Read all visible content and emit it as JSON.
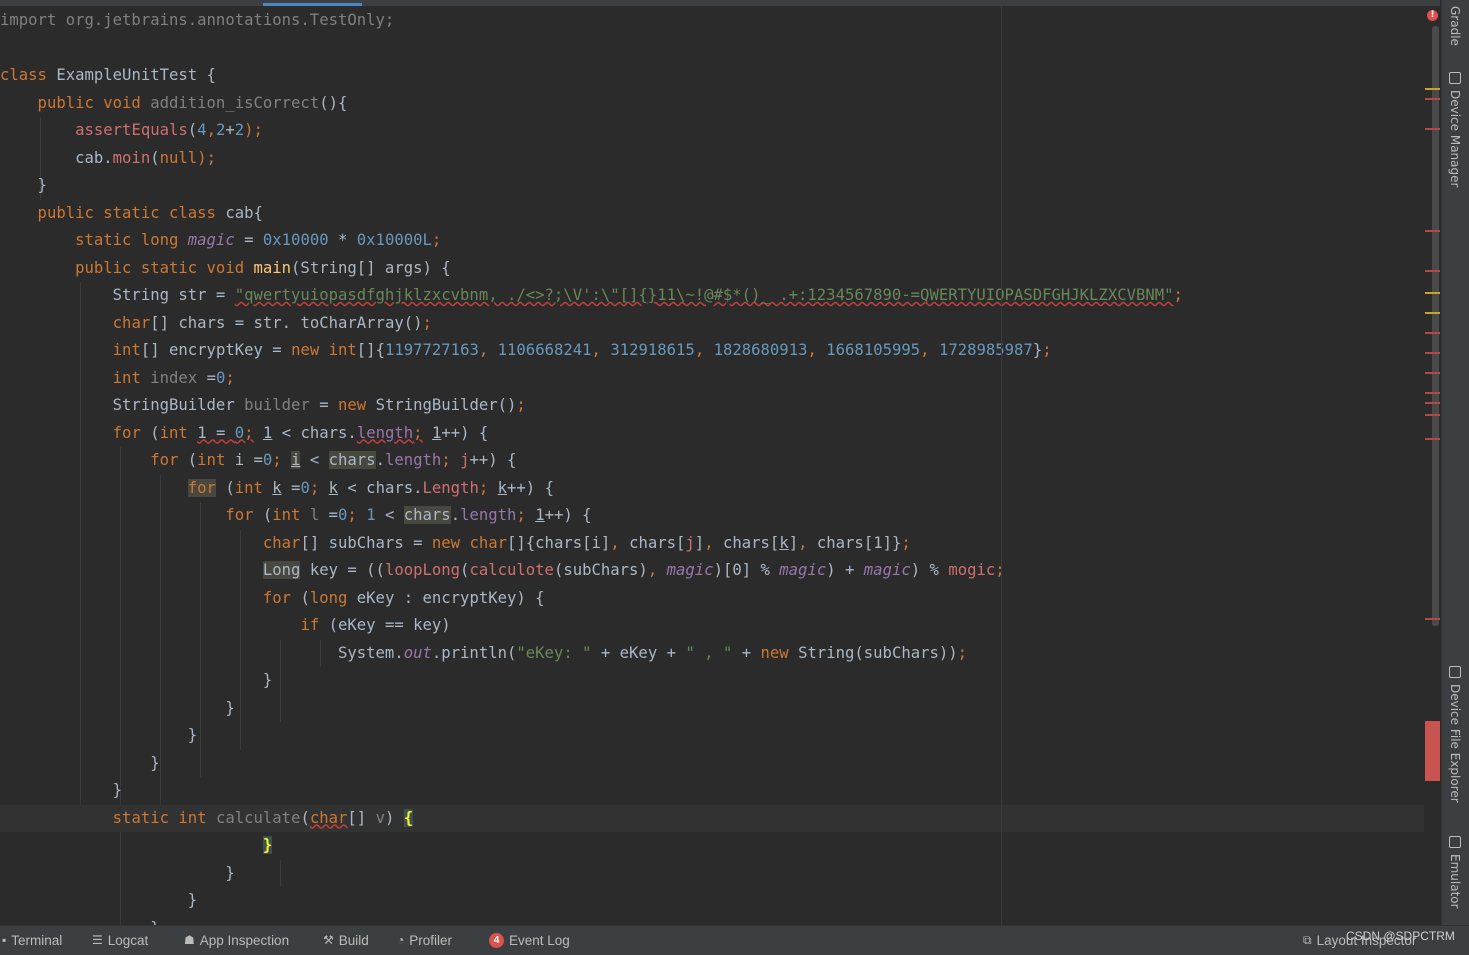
{
  "editor": {
    "lines": [
      {
        "segs": [
          {
            "t": "import org.jetbrains.annotations.TestOnly;",
            "c": "gry"
          }
        ]
      },
      {
        "segs": []
      },
      {
        "segs": [
          {
            "t": "class ",
            "c": "kw"
          },
          {
            "t": "ExampleUnitTest {",
            "c": ""
          }
        ]
      },
      {
        "segs": [
          {
            "t": "    public void ",
            "c": "kw"
          },
          {
            "t": "addition_isCorrect",
            "c": "gry"
          },
          {
            "t": "(){",
            "c": ""
          }
        ]
      },
      {
        "segs": [
          {
            "t": "        ",
            "c": ""
          },
          {
            "t": "assertEquals",
            "c": "mth"
          },
          {
            "t": "(",
            "c": ""
          },
          {
            "t": "4",
            "c": "num"
          },
          {
            "t": ",",
            "c": "kw"
          },
          {
            "t": "2",
            "c": "num"
          },
          {
            "t": "+",
            "c": ""
          },
          {
            "t": "2",
            "c": "num"
          },
          {
            "t": ");",
            "c": "kw"
          }
        ]
      },
      {
        "segs": [
          {
            "t": "        cab.",
            "c": ""
          },
          {
            "t": "moin",
            "c": "mth"
          },
          {
            "t": "(",
            "c": ""
          },
          {
            "t": "null",
            "c": "kw"
          },
          {
            "t": ");",
            "c": "kw"
          }
        ]
      },
      {
        "segs": [
          {
            "t": "    }",
            "c": ""
          }
        ]
      },
      {
        "segs": [
          {
            "t": "    public static class ",
            "c": "kw"
          },
          {
            "t": "cab{",
            "c": ""
          }
        ]
      },
      {
        "segs": [
          {
            "t": "        static long ",
            "c": "kw"
          },
          {
            "t": "magic",
            "c": "itl"
          },
          {
            "t": " = ",
            "c": ""
          },
          {
            "t": "0x10000",
            "c": "num"
          },
          {
            "t": " * ",
            "c": ""
          },
          {
            "t": "0x10000L",
            "c": "num"
          },
          {
            "t": ";",
            "c": "kw"
          }
        ]
      },
      {
        "segs": [
          {
            "t": "        public static void ",
            "c": "kw"
          },
          {
            "t": "main",
            "c": "fn"
          },
          {
            "t": "(String[] args) {",
            "c": ""
          }
        ]
      },
      {
        "segs": [
          {
            "t": "            String str = ",
            "c": ""
          },
          {
            "t": "\"qwertyuiopasdfghjklzxcvbnm, ./<>?;\\V':\\\"[]{}11\\~!@#$*()_ .+:1234567890-=QWERTYUIOPASDFGHJKLZXCVBNM\"",
            "c": "str err"
          },
          {
            "t": ";",
            "c": "kw"
          }
        ]
      },
      {
        "segs": [
          {
            "t": "            ",
            "c": ""
          },
          {
            "t": "char",
            "c": "kw"
          },
          {
            "t": "[] chars = str. toCharArray()",
            "c": ""
          },
          {
            "t": ";",
            "c": "kw"
          }
        ]
      },
      {
        "segs": [
          {
            "t": "            ",
            "c": ""
          },
          {
            "t": "int",
            "c": "kw"
          },
          {
            "t": "[] encryptKey = ",
            "c": ""
          },
          {
            "t": "new ",
            "c": "kw"
          },
          {
            "t": "int",
            "c": "kw"
          },
          {
            "t": "[]{",
            "c": ""
          },
          {
            "t": "1197727163",
            "c": "num"
          },
          {
            "t": ", ",
            "c": "kw"
          },
          {
            "t": "1106668241",
            "c": "num"
          },
          {
            "t": ", ",
            "c": "kw"
          },
          {
            "t": "312918615",
            "c": "num"
          },
          {
            "t": ", ",
            "c": "kw"
          },
          {
            "t": "1828680913",
            "c": "num"
          },
          {
            "t": ", ",
            "c": "kw"
          },
          {
            "t": "1668105995",
            "c": "num"
          },
          {
            "t": ", ",
            "c": "kw"
          },
          {
            "t": "1728985987",
            "c": "num"
          },
          {
            "t": "}",
            "c": ""
          },
          {
            "t": ";",
            "c": "kw"
          }
        ]
      },
      {
        "segs": [
          {
            "t": "            ",
            "c": ""
          },
          {
            "t": "int ",
            "c": "kw"
          },
          {
            "t": "index",
            "c": "gry"
          },
          {
            "t": " =",
            "c": ""
          },
          {
            "t": "0",
            "c": "num"
          },
          {
            "t": ";",
            "c": "kw"
          }
        ]
      },
      {
        "segs": [
          {
            "t": "            StringBuilder ",
            "c": ""
          },
          {
            "t": "builder",
            "c": "gry"
          },
          {
            "t": " = ",
            "c": ""
          },
          {
            "t": "new ",
            "c": "kw"
          },
          {
            "t": "StringBuilder()",
            "c": ""
          },
          {
            "t": ";",
            "c": "kw"
          }
        ]
      },
      {
        "segs": [
          {
            "t": "            ",
            "c": ""
          },
          {
            "t": "for ",
            "c": "kw"
          },
          {
            "t": "(",
            "c": ""
          },
          {
            "t": "int ",
            "c": "kw"
          },
          {
            "t": "1 = ",
            "c": "err"
          },
          {
            "t": "0",
            "c": "num err"
          },
          {
            "t": ";",
            "c": "kw err"
          },
          {
            "t": " ",
            "c": ""
          },
          {
            "t": "1",
            "c": "usc"
          },
          {
            "t": " < chars.",
            "c": ""
          },
          {
            "t": "length",
            "c": "purp err"
          },
          {
            "t": ";",
            "c": "kw err"
          },
          {
            "t": " ",
            "c": ""
          },
          {
            "t": "1",
            "c": "usc"
          },
          {
            "t": "++) {",
            "c": ""
          }
        ]
      },
      {
        "segs": [
          {
            "t": "                ",
            "c": ""
          },
          {
            "t": "for ",
            "c": "kw"
          },
          {
            "t": "(",
            "c": ""
          },
          {
            "t": "int ",
            "c": "kw"
          },
          {
            "t": "i =",
            "c": ""
          },
          {
            "t": "0",
            "c": "num"
          },
          {
            "t": "; ",
            "c": "kw"
          },
          {
            "t": "i",
            "c": "hl usc"
          },
          {
            "t": " < ",
            "c": ""
          },
          {
            "t": "chars",
            "c": "hl"
          },
          {
            "t": ".",
            "c": ""
          },
          {
            "t": "length",
            "c": "purp"
          },
          {
            "t": "; ",
            "c": "kw"
          },
          {
            "t": "j",
            "c": "mth"
          },
          {
            "t": "++) {",
            "c": ""
          }
        ]
      },
      {
        "segs": [
          {
            "t": "                    ",
            "c": ""
          },
          {
            "t": "for",
            "c": "kw hl"
          },
          {
            "t": " (",
            "c": ""
          },
          {
            "t": "int ",
            "c": "kw"
          },
          {
            "t": "k",
            "c": "usc"
          },
          {
            "t": " =",
            "c": ""
          },
          {
            "t": "0",
            "c": "num"
          },
          {
            "t": "; ",
            "c": "kw"
          },
          {
            "t": "k",
            "c": "usc"
          },
          {
            "t": " < chars.",
            "c": ""
          },
          {
            "t": "Length",
            "c": "mth"
          },
          {
            "t": "; ",
            "c": "kw"
          },
          {
            "t": "k",
            "c": "usc"
          },
          {
            "t": "++) {",
            "c": ""
          }
        ]
      },
      {
        "segs": [
          {
            "t": "                        ",
            "c": ""
          },
          {
            "t": "for ",
            "c": "kw"
          },
          {
            "t": "(",
            "c": ""
          },
          {
            "t": "int ",
            "c": "kw"
          },
          {
            "t": "l",
            "c": "gry"
          },
          {
            "t": " =",
            "c": ""
          },
          {
            "t": "0",
            "c": "num"
          },
          {
            "t": "; ",
            "c": "kw"
          },
          {
            "t": "1",
            "c": "num"
          },
          {
            "t": " < ",
            "c": ""
          },
          {
            "t": "chars",
            "c": "hl"
          },
          {
            "t": ".",
            "c": ""
          },
          {
            "t": "length",
            "c": "purp"
          },
          {
            "t": "; ",
            "c": "kw"
          },
          {
            "t": "1",
            "c": "usc"
          },
          {
            "t": "++) {",
            "c": ""
          }
        ]
      },
      {
        "segs": [
          {
            "t": "                            ",
            "c": ""
          },
          {
            "t": "char",
            "c": "kw"
          },
          {
            "t": "[] subChars = ",
            "c": ""
          },
          {
            "t": "new ",
            "c": "kw"
          },
          {
            "t": "char",
            "c": "kw"
          },
          {
            "t": "[]{chars[i]",
            "c": ""
          },
          {
            "t": ", ",
            "c": "kw"
          },
          {
            "t": "chars[",
            "c": ""
          },
          {
            "t": "j",
            "c": "mth"
          },
          {
            "t": "]",
            "c": ""
          },
          {
            "t": ", ",
            "c": "kw"
          },
          {
            "t": "chars[",
            "c": ""
          },
          {
            "t": "k",
            "c": "usc"
          },
          {
            "t": "]",
            "c": ""
          },
          {
            "t": ", ",
            "c": "kw"
          },
          {
            "t": "chars[1]}",
            "c": ""
          },
          {
            "t": ";",
            "c": "kw"
          }
        ]
      },
      {
        "segs": [
          {
            "t": "                            ",
            "c": ""
          },
          {
            "t": "Long",
            "c": "hl"
          },
          {
            "t": " key = ((",
            "c": ""
          },
          {
            "t": "loopLong",
            "c": "mth"
          },
          {
            "t": "(",
            "c": ""
          },
          {
            "t": "calculote",
            "c": "mth"
          },
          {
            "t": "(subChars)",
            "c": ""
          },
          {
            "t": ", ",
            "c": "kw"
          },
          {
            "t": "magic",
            "c": "itl"
          },
          {
            "t": ")[0] % ",
            "c": ""
          },
          {
            "t": "magic",
            "c": "itl"
          },
          {
            "t": ") + ",
            "c": ""
          },
          {
            "t": "magic",
            "c": "itl"
          },
          {
            "t": ") % ",
            "c": ""
          },
          {
            "t": "mogic",
            "c": "mth"
          },
          {
            "t": ";",
            "c": "kw"
          }
        ]
      },
      {
        "segs": [
          {
            "t": "                            ",
            "c": ""
          },
          {
            "t": "for ",
            "c": "kw"
          },
          {
            "t": "(",
            "c": ""
          },
          {
            "t": "long ",
            "c": "kw"
          },
          {
            "t": "eKey : encryptKey) {",
            "c": ""
          }
        ]
      },
      {
        "segs": [
          {
            "t": "                                ",
            "c": ""
          },
          {
            "t": "if ",
            "c": "kw"
          },
          {
            "t": "(eKey == key)",
            "c": ""
          }
        ]
      },
      {
        "segs": [
          {
            "t": "                                    System.",
            "c": ""
          },
          {
            "t": "out",
            "c": "itl"
          },
          {
            "t": ".println(",
            "c": ""
          },
          {
            "t": "\"eKey: \"",
            "c": "str"
          },
          {
            "t": " + eKey + ",
            "c": ""
          },
          {
            "t": "\" , \"",
            "c": "str"
          },
          {
            "t": " + ",
            "c": ""
          },
          {
            "t": "new ",
            "c": "kw"
          },
          {
            "t": "String(subChars))",
            "c": ""
          },
          {
            "t": ";",
            "c": "kw"
          }
        ]
      },
      {
        "segs": [
          {
            "t": "                            }",
            "c": ""
          }
        ]
      },
      {
        "segs": [
          {
            "t": "                        }",
            "c": ""
          }
        ]
      },
      {
        "segs": [
          {
            "t": "                    }",
            "c": ""
          }
        ]
      },
      {
        "segs": [
          {
            "t": "                }",
            "c": ""
          }
        ]
      },
      {
        "segs": [
          {
            "t": "            }",
            "c": ""
          }
        ]
      },
      {
        "segs": [
          {
            "t": "            ",
            "c": ""
          },
          {
            "t": "static int ",
            "c": "kw"
          },
          {
            "t": "calculate",
            "c": "gry"
          },
          {
            "t": "(",
            "c": ""
          },
          {
            "t": "char",
            "c": "kw err"
          },
          {
            "t": "[] ",
            "c": ""
          },
          {
            "t": "v",
            "c": "gry"
          },
          {
            "t": ") ",
            "c": ""
          },
          {
            "t": "{",
            "c": "brc"
          }
        ]
      },
      {
        "segs": [
          {
            "t": "                            ",
            "c": ""
          },
          {
            "t": "}",
            "c": "brc"
          }
        ]
      },
      {
        "segs": [
          {
            "t": "                        }",
            "c": ""
          }
        ]
      },
      {
        "segs": [
          {
            "t": "                    }",
            "c": ""
          }
        ]
      },
      {
        "segs": [
          {
            "t": "                }",
            "c": ""
          }
        ]
      }
    ]
  },
  "right_tools": [
    "Gradle",
    "Device Manager",
    "Device File Explorer",
    "Emulator"
  ],
  "status": {
    "terminal": "Terminal",
    "logcat": "Logcat",
    "app_inspection": "App Inspection",
    "build": "Build",
    "profiler": "Profiler",
    "event_log": "Event Log",
    "event_count": "4",
    "layout_inspector": "Layout Inspector"
  },
  "watermark": "CSDN @SDPCTRM",
  "error_indicator": "!"
}
